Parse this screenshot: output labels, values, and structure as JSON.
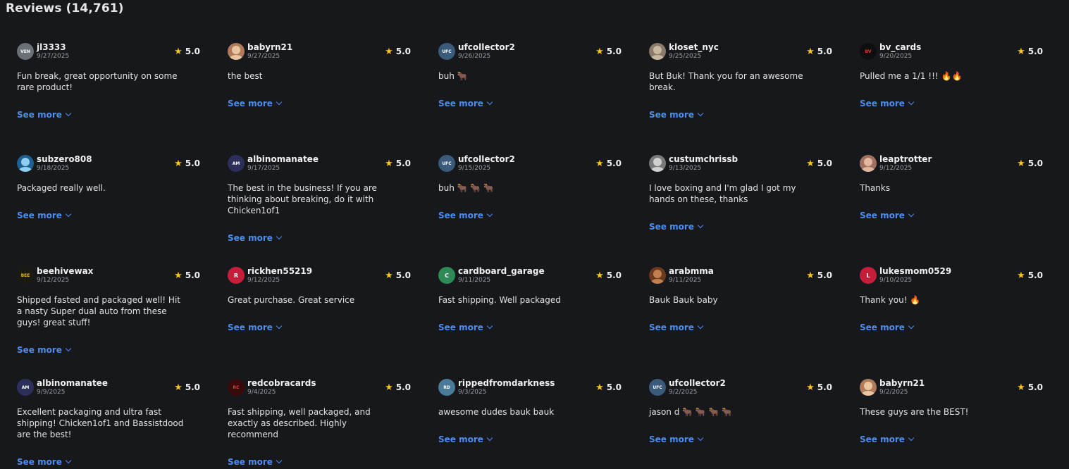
{
  "header": {
    "title": "Reviews (14,761)"
  },
  "reviews": [
    {
      "user": "jl3333",
      "date": "9/27/2025",
      "rating": "5.0",
      "text": "Fun break, great opportunity on some rare product!",
      "see_more": "See more",
      "avatar": {
        "type": "logo",
        "label": "VEN",
        "bg": "#6b6f78",
        "fg": "#ffffff"
      }
    },
    {
      "user": "babyrn21",
      "date": "9/27/2025",
      "rating": "5.0",
      "text": "the best",
      "see_more": "See more",
      "avatar": {
        "type": "photo",
        "bg": "#b07b5a",
        "fg": "#e8c7a0"
      }
    },
    {
      "user": "ufcollector2",
      "date": "9/26/2025",
      "rating": "5.0",
      "text": "buh 🐂",
      "see_more": "See more",
      "avatar": {
        "type": "logo",
        "label": "UFC",
        "bg": "#3a5a7a",
        "fg": "#ffffff"
      }
    },
    {
      "user": "kloset_nyc",
      "date": "9/25/2025",
      "rating": "5.0",
      "text": "But Buk! Thank you for an awesome break.",
      "see_more": "See more",
      "avatar": {
        "type": "photo",
        "bg": "#8a7a6a",
        "fg": "#c9b8a0"
      }
    },
    {
      "user": "bv_cards",
      "date": "9/20/2025",
      "rating": "5.0",
      "text": "Pulled me a 1/1 !!! 🔥🔥",
      "see_more": "See more",
      "avatar": {
        "type": "logo",
        "label": "BV",
        "bg": "#0e0e0e",
        "fg": "#e23c3c"
      }
    },
    {
      "user": "subzero808",
      "date": "9/18/2025",
      "rating": "5.0",
      "text": "Packaged really well.",
      "see_more": "See more",
      "avatar": {
        "type": "photo",
        "bg": "#1f5f8f",
        "fg": "#8fd0f0"
      }
    },
    {
      "user": "albinomanatee",
      "date": "9/17/2025",
      "rating": "5.0",
      "text": "The best in the business! If you are thinking about breaking, do it with Chicken1of1",
      "see_more": "See more",
      "avatar": {
        "type": "logo",
        "label": "AM",
        "bg": "#2b2f5a",
        "fg": "#ffffff"
      }
    },
    {
      "user": "ufcollector2",
      "date": "9/15/2025",
      "rating": "5.0",
      "text": "buh 🐂 🐂 🐂",
      "see_more": "See more",
      "avatar": {
        "type": "logo",
        "label": "UFC",
        "bg": "#3a5a7a",
        "fg": "#ffffff"
      }
    },
    {
      "user": "custumchrissb",
      "date": "9/13/2025",
      "rating": "5.0",
      "text": "I love boxing and I'm glad I got my hands on these, thanks",
      "see_more": "See more",
      "avatar": {
        "type": "photo",
        "bg": "#7a7a7a",
        "fg": "#d0d0d0"
      }
    },
    {
      "user": "leaptrotter",
      "date": "9/12/2025",
      "rating": "5.0",
      "text": "Thanks",
      "see_more": "See more",
      "avatar": {
        "type": "photo",
        "bg": "#a07060",
        "fg": "#e0b8a0"
      }
    },
    {
      "user": "beehivewax",
      "date": "9/12/2025",
      "rating": "5.0",
      "text": "Shipped fasted and packaged well! Hit a nasty Super dual auto from these guys! great stuff!",
      "see_more": "See more",
      "avatar": {
        "type": "logo",
        "label": "BEE",
        "bg": "#1a1a10",
        "fg": "#e8b820"
      }
    },
    {
      "user": "rickhen55219",
      "date": "9/12/2025",
      "rating": "5.0",
      "text": "Great purchase. Great service",
      "see_more": "See more",
      "avatar": {
        "type": "letter",
        "label": "R",
        "bg": "#c41e3a",
        "fg": "#ffffff"
      }
    },
    {
      "user": "cardboard_garage",
      "date": "9/11/2025",
      "rating": "5.0",
      "text": "Fast shipping. Well packaged",
      "see_more": "See more",
      "avatar": {
        "type": "letter",
        "label": "C",
        "bg": "#2e8b57",
        "fg": "#ffffff"
      }
    },
    {
      "user": "arabmma",
      "date": "9/11/2025",
      "rating": "5.0",
      "text": "Bauk Bauk baby",
      "see_more": "See more",
      "avatar": {
        "type": "photo",
        "bg": "#6b3a1e",
        "fg": "#c08050"
      }
    },
    {
      "user": "lukesmom0529",
      "date": "9/10/2025",
      "rating": "5.0",
      "text": "Thank you! 🔥",
      "see_more": "See more",
      "avatar": {
        "type": "letter",
        "label": "L",
        "bg": "#c41e3a",
        "fg": "#ffffff"
      }
    },
    {
      "user": "albinomanatee",
      "date": "9/9/2025",
      "rating": "5.0",
      "text": "Excellent packaging and ultra fast shipping! Chicken1of1 and Bassistdood are the best!",
      "see_more": "See more",
      "avatar": {
        "type": "logo",
        "label": "AM",
        "bg": "#2b2f5a",
        "fg": "#ffffff"
      }
    },
    {
      "user": "redcobracards",
      "date": "9/4/2025",
      "rating": "5.0",
      "text": "Fast shipping, well packaged, and exactly as described. Highly recommend",
      "see_more": "See more",
      "avatar": {
        "type": "logo",
        "label": "RC",
        "bg": "#3a0a0a",
        "fg": "#e23c3c"
      }
    },
    {
      "user": "rippedfromdarkness",
      "date": "9/3/2025",
      "rating": "5.0",
      "text": "awesome dudes bauk bauk",
      "see_more": "See more",
      "avatar": {
        "type": "logo",
        "label": "RD",
        "bg": "#4a7a9a",
        "fg": "#ffffff"
      }
    },
    {
      "user": "ufcollector2",
      "date": "9/2/2025",
      "rating": "5.0",
      "text": "jason d 🐂 🐂 🐂 🐂",
      "see_more": "See more",
      "avatar": {
        "type": "logo",
        "label": "UFC",
        "bg": "#3a5a7a",
        "fg": "#ffffff"
      }
    },
    {
      "user": "babyrn21",
      "date": "9/2/2025",
      "rating": "5.0",
      "text": "These guys are the BEST!",
      "see_more": "See more",
      "avatar": {
        "type": "photo",
        "bg": "#b07b5a",
        "fg": "#e8c7a0"
      }
    }
  ],
  "icons": {
    "star": "star-icon",
    "chevron": "chevron-down-icon"
  },
  "colors": {
    "accent": "#4c8df0",
    "star": "#f5c518",
    "background": "#17181b"
  }
}
